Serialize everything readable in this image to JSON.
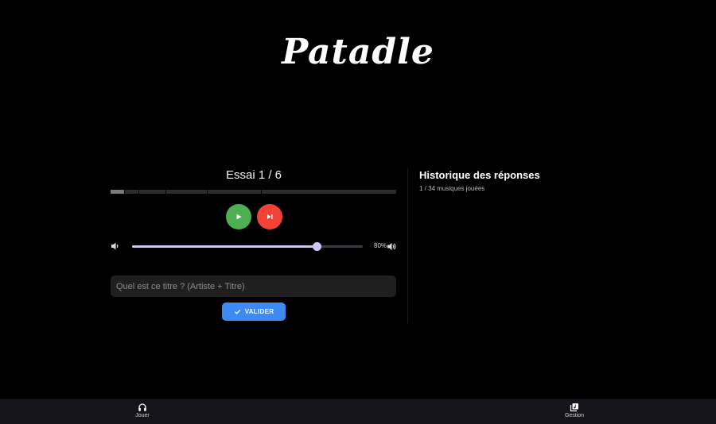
{
  "app": {
    "logo_text": "Patadle"
  },
  "game": {
    "attempt_label": "Essai 1 / 6",
    "progress_segments": [
      {
        "portion": 1,
        "filled": true
      },
      {
        "portion": 1,
        "filled": false
      },
      {
        "portion": 2,
        "filled": false
      },
      {
        "portion": 3,
        "filled": false
      },
      {
        "portion": 4,
        "filled": false
      },
      {
        "portion": 10,
        "filled": false
      }
    ],
    "play_icon": "play-icon",
    "skip_icon": "skip-next-icon",
    "colors": {
      "play": "#4caf50",
      "skip": "#f44336",
      "validate": "#3d8bf2",
      "slider": "#cfc6ff"
    },
    "volume": {
      "value": 0.8,
      "label": "80%"
    },
    "answer": {
      "value": "",
      "placeholder": "Quel est ce titre ? (Artiste + Titre)"
    },
    "validate_label": "VALIDER"
  },
  "history": {
    "title": "Historique des réponses",
    "subtitle": "1 / 34 musiques jouées"
  },
  "nav": {
    "items": [
      {
        "label": "Jouer",
        "icon": "headphones-icon"
      },
      {
        "label": "Gestion",
        "icon": "library-music-icon"
      }
    ]
  }
}
